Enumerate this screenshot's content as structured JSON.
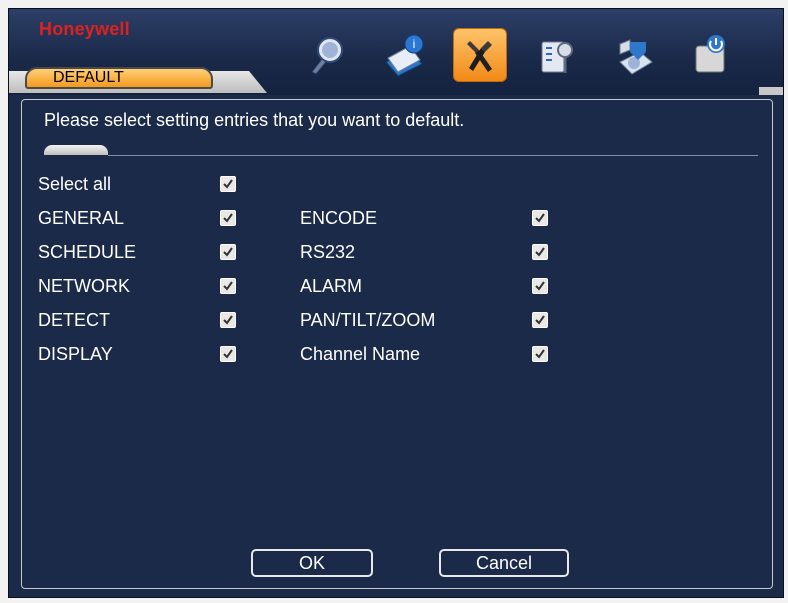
{
  "header": {
    "brand": "Honeywell",
    "tab_label": "DEFAULT",
    "toolbar_icons": [
      {
        "name": "search-icon",
        "active": false
      },
      {
        "name": "info-book-icon",
        "active": false
      },
      {
        "name": "tools-icon",
        "active": true
      },
      {
        "name": "user-account-icon",
        "active": false
      },
      {
        "name": "backup-icon",
        "active": false
      },
      {
        "name": "shutdown-icon",
        "active": false
      }
    ]
  },
  "content": {
    "instruction": "Please select setting entries that you want to default.",
    "select_all": {
      "label": "Select all",
      "checked": true
    },
    "left_items": [
      {
        "label": "GENERAL",
        "checked": true
      },
      {
        "label": "SCHEDULE",
        "checked": true
      },
      {
        "label": "NETWORK",
        "checked": true
      },
      {
        "label": "DETECT",
        "checked": true
      },
      {
        "label": "DISPLAY",
        "checked": true
      }
    ],
    "right_items": [
      {
        "label": "ENCODE",
        "checked": true
      },
      {
        "label": "RS232",
        "checked": true
      },
      {
        "label": "ALARM",
        "checked": true
      },
      {
        "label": "PAN/TILT/ZOOM",
        "checked": true
      },
      {
        "label": "Channel Name",
        "checked": true
      }
    ]
  },
  "buttons": {
    "ok": "OK",
    "cancel": "Cancel"
  },
  "colors": {
    "background": "#1c2a4a",
    "accent": "#f39a1c",
    "brand": "#e0201c"
  }
}
